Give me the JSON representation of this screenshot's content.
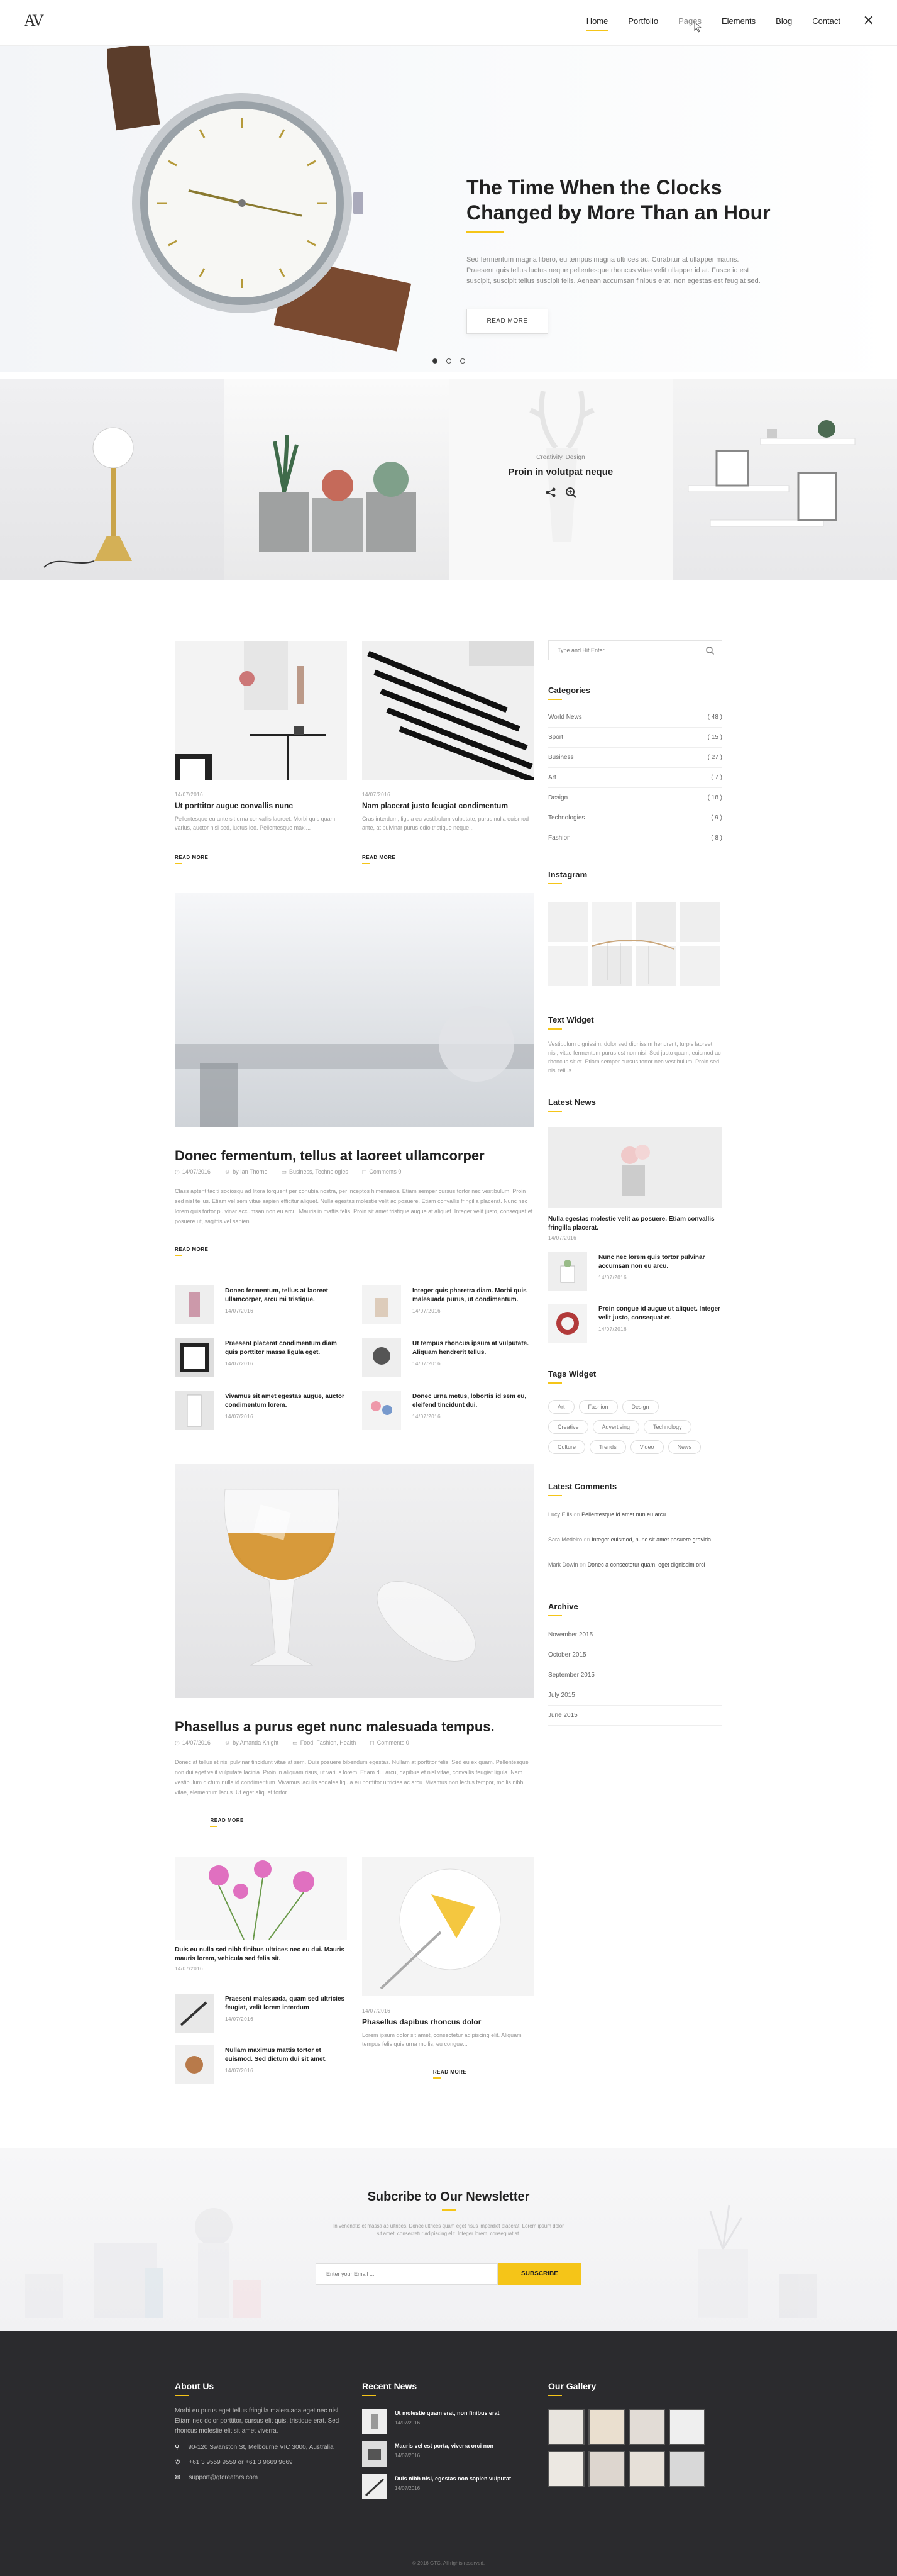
{
  "header": {
    "logo": "AV",
    "nav": [
      "Home",
      "Portfolio",
      "Pages",
      "Elements",
      "Blog",
      "Contact"
    ],
    "close": "✕"
  },
  "hero": {
    "title": "The Time When the Clocks Changed by More Than an Hour",
    "text": "Sed fermentum magna libero, eu tempus magna ultrices ac. Curabitur at ullapper mauris. Praesent quis tellus luctus neque pellentesque rhoncus vitae velit ullapper id at. Fusce id est suscipit, suscipit tellus suscipit felis. Aenean accumsan finibus erat, non egestas est feugiat sed.",
    "button": "READ MORE"
  },
  "tiles": {
    "category": "Creativity, Design",
    "title": "Proin in volutpat neque"
  },
  "posts_top": [
    {
      "date": "14/07/2016",
      "title": "Ut porttitor augue convallis nunc",
      "excerpt": "Pellentesque eu ante sit urna convallis laoreet. Morbi quis quam varius, auctor nisi sed, luctus leo. Pellentesque maxi...",
      "more": "READ MORE"
    },
    {
      "date": "14/07/2016",
      "title": "Nam placerat justo feugiat condimentum",
      "excerpt": "Cras interdum, ligula eu vestibulum vulputate, purus nulla euismod ante, at pulvinar purus odio tristique neque...",
      "more": "READ MORE"
    }
  ],
  "post_big1": {
    "title": "Donec fermentum, tellus at laoreet ullamcorper",
    "meta": [
      "14/07/2016",
      "by Ian Thorne",
      "Business, Technologies",
      "Comments 0"
    ],
    "text": "Class aptent taciti sociosqu ad litora torquent per conubia nostra, per inceptos himenaeos. Etiam semper cursus tortor nec vestibulum. Proin sed nisl tellus. Etiam vel sem vitae sapien efficitur aliquet. Nulla egestas molestie velit ac posuere. Etiam convallis fringilla placerat. Nunc nec lorem quis tortor pulvinar accumsan non eu arcu. Mauris in mattis felis. Proin sit amet tristique augue at aliquet. Integer velit justo, consequat et posuere ut, sagittis vel sapien.",
    "more": "READ MORE"
  },
  "mini_posts": [
    {
      "title": "Donec fermentum, tellus at laoreet ullamcorper, arcu mi tristique.",
      "date": "14/07/2016"
    },
    {
      "title": "Integer quis pharetra diam. Morbi quis malesuada purus, ut condimentum.",
      "date": "14/07/2016"
    },
    {
      "title": "Praesent placerat condimentum diam quis porttitor massa ligula eget.",
      "date": "14/07/2016"
    },
    {
      "title": "Ut tempus rhoncus ipsum at vulputate. Aliquam hendrerit tellus.",
      "date": "14/07/2016"
    },
    {
      "title": "Vivamus sit amet egestas augue, auctor condimentum lorem.",
      "date": "14/07/2016"
    },
    {
      "title": "Donec urna metus, lobortis id sem eu, eleifend tincidunt dui.",
      "date": "14/07/2016"
    }
  ],
  "post_big2": {
    "title": "Phasellus a purus eget nunc malesuada tempus.",
    "meta": [
      "14/07/2016",
      "by Amanda Knight",
      "Food, Fashion, Health",
      "Comments 0"
    ],
    "text": "Donec at tellus et nisl pulvinar tincidunt vitae at sem. Duis posuere bibendum egestas. Nullam at porttitor felis. Sed eu ex quam. Pellentesque non dui eget velit vulputate lacinia. Proin in aliquam risus, ut varius lorem. Etiam dui arcu, dapibus et nisl vitae, convallis feugiat ligula. Nam vestibulum dictum nulla id condimentum. Vivamus iaculis sodales ligula eu porttitor ultricies ac arcu. Vivamus non lectus tempor, mollis nibh vitae, elementum lacus. Ut eget aliquet tortor.",
    "more": "READ MORE"
  },
  "bottom_left": {
    "title": "Duis eu nulla sed nibh finibus ultrices nec eu dui. Mauris mauris lorem, vehicula sed felis sit.",
    "date": "14/07/2016",
    "minis": [
      {
        "title": "Praesent malesuada, quam sed ultricies feugiat, velit lorem interdum",
        "date": "14/07/2016"
      },
      {
        "title": "Nullam maximus mattis tortor et euismod. Sed dictum dui sit amet.",
        "date": "14/07/2016"
      }
    ]
  },
  "bottom_right": {
    "date": "14/07/2016",
    "title": "Phasellus dapibus rhoncus dolor",
    "excerpt": "Lorem ipsum dolor sit amet, consectetur adipiscing elit. Aliquam tempus felis quis urna mollis, eu congue...",
    "more": "READ MORE"
  },
  "sidebar": {
    "search_placeholder": "Type and Hit Enter ...",
    "categories_title": "Categories",
    "categories": [
      {
        "name": "World News",
        "count": "( 48 )"
      },
      {
        "name": "Sport",
        "count": "( 15 )"
      },
      {
        "name": "Business",
        "count": "( 27 )"
      },
      {
        "name": "Art",
        "count": "( 7 )"
      },
      {
        "name": "Design",
        "count": "( 18 )"
      },
      {
        "name": "Technologies",
        "count": "( 9 )"
      },
      {
        "name": "Fashion",
        "count": "( 8 )"
      }
    ],
    "instagram_title": "Instagram",
    "text_widget_title": "Text Widget",
    "text_widget": "Vestibulum dignissim, dolor sed dignissim hendrerit, turpis laoreet nisi, vitae fermentum purus est non nisi. Sed justo quam, euismod ac rhoncus sit et. Etiam semper cursus tortor nec vestibulum. Proin sed nisl tellus.",
    "latest_news_title": "Latest News",
    "latest_news_featured": {
      "title": "Nulla egestas molestie velit ac posuere. Etiam convallis fringilla placerat.",
      "date": "14/07/2016"
    },
    "latest_news": [
      {
        "title": "Nunc nec lorem quis tortor pulvinar accumsan non eu arcu.",
        "date": "14/07/2016"
      },
      {
        "title": "Proin congue id augue ut aliquet. Integer velit justo, consequat et.",
        "date": "14/07/2016"
      }
    ],
    "tags_title": "Tags Widget",
    "tags": [
      "Art",
      "Fashion",
      "Design",
      "Creative",
      "Advertising",
      "Technology",
      "Culture",
      "Trends",
      "Video",
      "News"
    ],
    "comments_title": "Latest Comments",
    "comments": [
      {
        "author": "Lucy Ellis",
        "on": "on",
        "text": "Pellentesque id amet nun eu arcu"
      },
      {
        "author": "Sara Medeiro",
        "on": "on",
        "text": "Integer euismod, nunc sit amet posuere gravida"
      },
      {
        "author": "Mark Dowin",
        "on": "on",
        "text": "Donec a consectetur quam, eget dignissim orci"
      }
    ],
    "archive_title": "Archive",
    "archive": [
      "November 2015",
      "October 2015",
      "September 2015",
      "July 2015",
      "June 2015"
    ]
  },
  "newsletter": {
    "title": "Subcribe to Our Newsletter",
    "text": "In venenatis et massa ac ultrices. Donec ultrices quam eget risus imperdiet placerat. Lorem ipsum dolor sit amet, consectetur adipiscing elit. Integer lorem, consequat at.",
    "placeholder": "Enter your Email ...",
    "button": "SUBSCRIBE"
  },
  "footer": {
    "about_title": "About Us",
    "about_text": "Morbi eu purus eget tellus fringilla malesuada eget nec nisl. Etiam nec dolor porttitor, cursus elit quis, tristique erat. Sed rhoncus molestie elit sit amet viverra.",
    "address": "90-120 Swanston St, Melbourne VIC 3000, Australia",
    "phone": "+61 3 9559 9559 or +61 3 9669 9669",
    "email": "support@gtcreators.com",
    "recent_title": "Recent News",
    "recent": [
      {
        "title": "Ut molestie quam erat, non finibus erat",
        "date": "14/07/2016"
      },
      {
        "title": "Mauris vel est porta, viverra orci non",
        "date": "14/07/2016"
      },
      {
        "title": "Duis nibh nisl, egestas non sapien vulputat",
        "date": "14/07/2016"
      }
    ],
    "gallery_title": "Our Gallery",
    "copyright": "© 2016 GTC. All rights reserved."
  },
  "colors": {
    "accent": "#f5c518",
    "footer_bg": "#2b2b2e"
  }
}
